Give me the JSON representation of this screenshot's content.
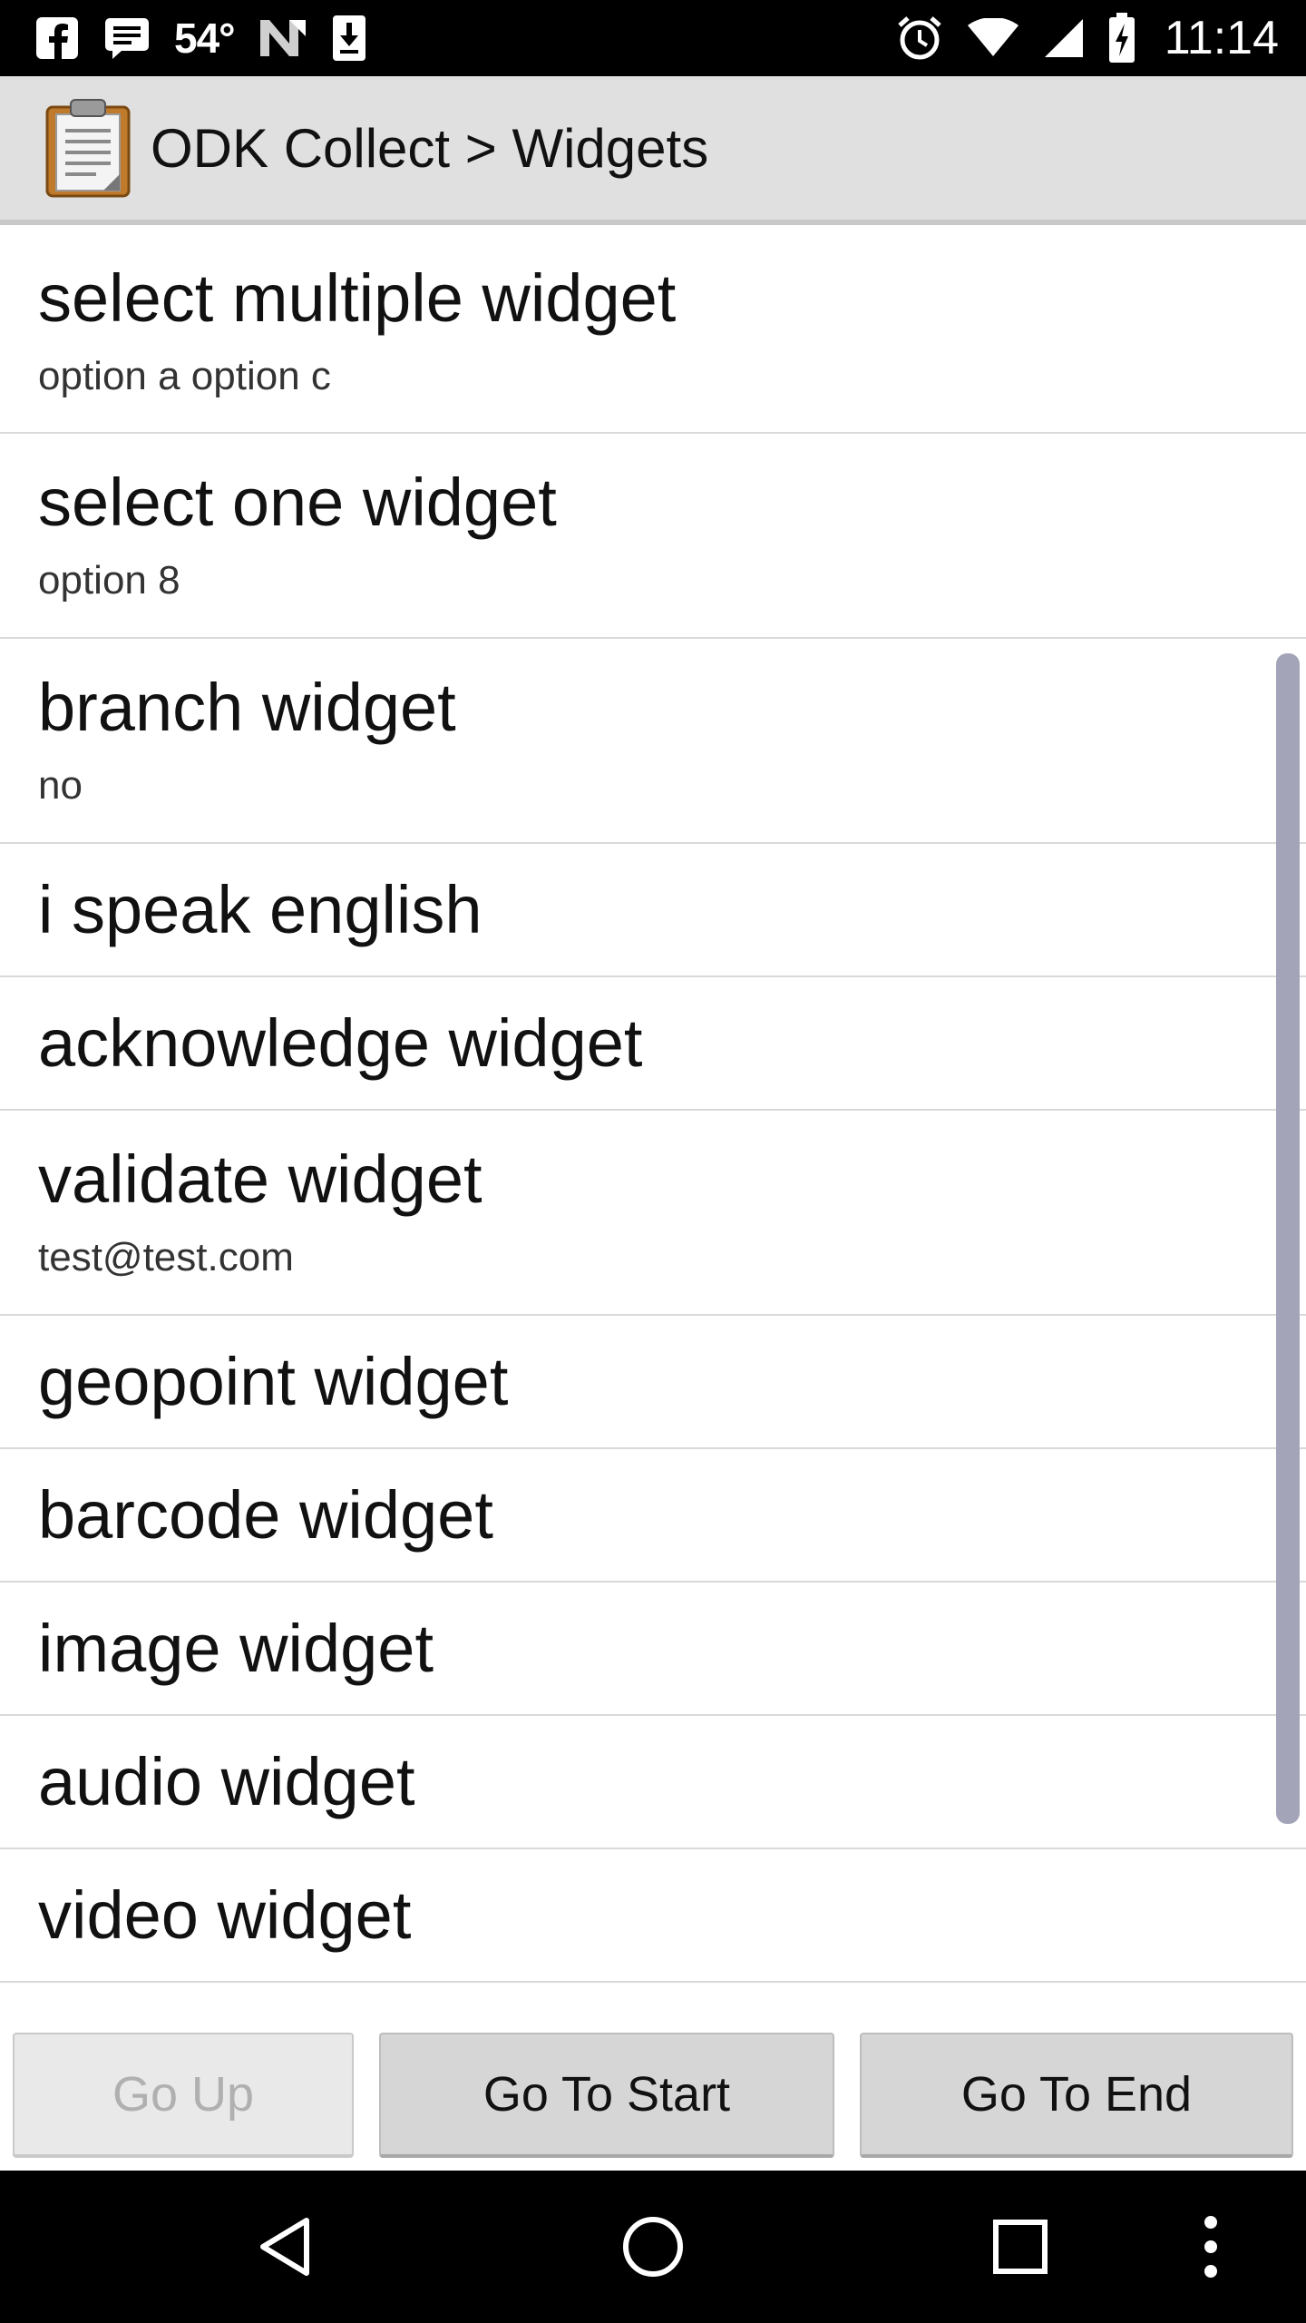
{
  "status_bar": {
    "temperature": "54°",
    "time": "11:14",
    "icons": [
      "facebook-icon",
      "message-icon",
      "weather-icon",
      "n-icon",
      "download-icon",
      "alarm-icon",
      "wifi-icon",
      "signal-icon",
      "battery-charging-icon"
    ]
  },
  "header": {
    "app_icon": "clipboard-icon",
    "title": "ODK Collect > Widgets"
  },
  "list": {
    "items": [
      {
        "title": "select multiple widget",
        "subtitle": "option a option c"
      },
      {
        "title": "select one widget",
        "subtitle": "option 8"
      },
      {
        "title": "branch widget",
        "subtitle": "no"
      },
      {
        "title": "i speak english",
        "subtitle": ""
      },
      {
        "title": "acknowledge widget",
        "subtitle": ""
      },
      {
        "title": "validate widget",
        "subtitle": "test@test.com"
      },
      {
        "title": "geopoint widget",
        "subtitle": ""
      },
      {
        "title": "barcode widget",
        "subtitle": ""
      },
      {
        "title": "image widget",
        "subtitle": ""
      },
      {
        "title": "audio widget",
        "subtitle": ""
      },
      {
        "title": "video widget",
        "subtitle": ""
      }
    ]
  },
  "buttons": {
    "go_up": "Go Up",
    "go_to_start": "Go To Start",
    "go_to_end": "Go To End"
  },
  "nav_bar": {
    "icons": [
      "back-icon",
      "home-icon",
      "recents-icon",
      "overflow-menu-icon"
    ]
  },
  "colors": {
    "status_bar": "#000000",
    "title_bar": "#e0e0e0",
    "scroll_thumb": "#a4a4b8",
    "button": "#d6d6d6"
  }
}
